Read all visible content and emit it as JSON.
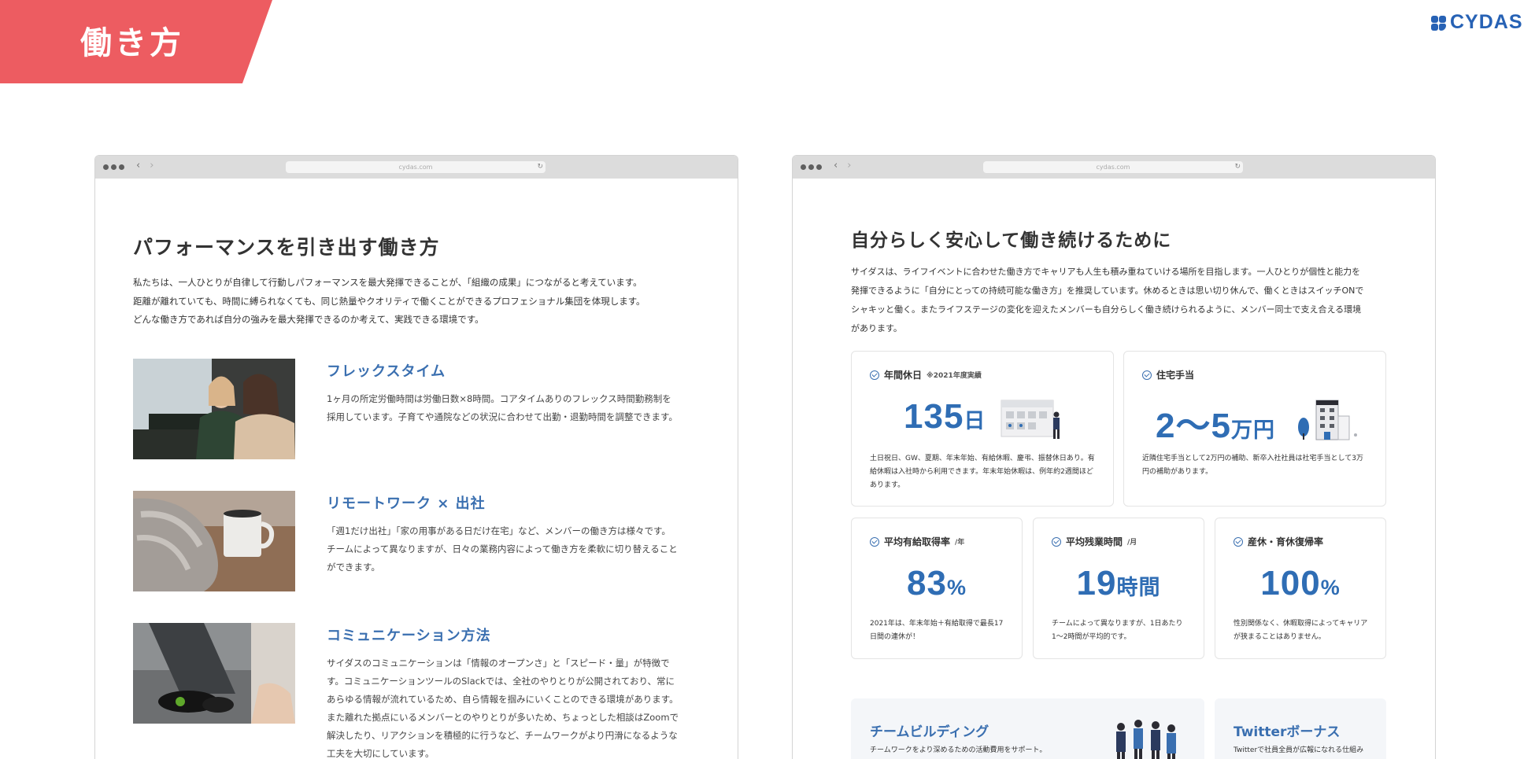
{
  "banner": {
    "title": "働き方"
  },
  "logo": {
    "text": "CYDAS"
  },
  "browser": {
    "url": "cydas.com"
  },
  "left": {
    "title": "パフォーマンスを引き出す働き方",
    "intro": [
      "私たちは、一人ひとりが自律して行動しパフォーマンスを最大発揮できることが、「組織の成果」につながると考えています。",
      "距離が離れていても、時間に縛られなくても、同じ熱量やクオリティで働くことができるプロフェショナル集団を体現します。",
      "どんな働き方であれば自分の強みを最大発揮できるのか考えて、実践できる環境です。"
    ],
    "features": [
      {
        "title": "フレックスタイム",
        "lines": [
          "1ヶ月の所定労働時間は労働日数×8時間。コアタイムありのフレックス時間勤務制を",
          "採用しています。子育てや通院などの状況に合わせて出勤・退勤時間を調整できます。"
        ]
      },
      {
        "title": "リモートワーク × 出社",
        "lines": [
          "「週1だけ出社」「家の用事がある日だけ在宅」など、メンバーの働き方は様々です。",
          "チームによって異なりますが、日々の業務内容によって働き方を柔軟に切り替えること",
          "ができます。"
        ]
      },
      {
        "title": "コミュニケーション方法",
        "lines": [
          "サイダスのコミュニケーションは「情報のオープンさ」と「スピード・量」が特徴で",
          "す。コミュニケーションツールのSlackでは、全社のやりとりが公開されており、常に",
          "あらゆる情報が流れているため、自ら情報を掴みにいくことのできる環境があります。",
          "また離れた拠点にいるメンバーとのやりとりが多いため、ちょっとした相談はZoomで",
          "解決したり、リアクションを積極的に行うなど、チームワークがより円滑になるような",
          "工夫を大切にしています。"
        ]
      }
    ]
  },
  "right": {
    "title": "自分らしく安心して働き続けるために",
    "intro": [
      "サイダスは、ライフイベントに合わせた働き方でキャリアも人生も積み重ねていける場所を目指します。一人ひとりが個性と能力を",
      "発揮できるように「自分にとっての持続可能な働き方」を推奨しています。休めるときは思い切り休んで、働くときはスイッチONで",
      "シャキッと働く。またライフステージの変化を迎えたメンバーも自分らしく働き続けられるように、メンバー同士で支え合える環境",
      "があります。"
    ],
    "cards": {
      "holidays": {
        "label": "年間休日",
        "note": "※2021年度実績",
        "value": "135",
        "unit": "日",
        "lines": [
          "土日祝日、GW、夏期、年末年始、有給休暇、慶弔、振替休日あり。有",
          "給休暇は入社時から利用できます。年末年始休暇は、例年約2週間ほど",
          "あります。"
        ]
      },
      "housing": {
        "label": "住宅手当",
        "value": "2〜5",
        "unit": "万円",
        "lines": [
          "近隣住宅手当として2万円の補助、新卒入社社員は社宅手当として3万",
          "円の補助があります。"
        ]
      },
      "paid_leave": {
        "label": "平均有給取得率",
        "suffix": "/年",
        "value": "83",
        "unit": "%",
        "lines": [
          "2021年は、年末年始＋有給取得で最長17",
          "日間の連休が！"
        ]
      },
      "overtime": {
        "label": "平均残業時間",
        "suffix": "/月",
        "value": "19",
        "unit": "時間",
        "lines": [
          "チームによって異なりますが、1日あたり",
          "1〜2時間が平均的です。"
        ]
      },
      "return_rate": {
        "label": "産休・育休復帰率",
        "value": "100",
        "unit": "%",
        "lines": [
          "性別関係なく、休暇取得によってキャリア",
          "が狭まることはありません。"
        ]
      }
    },
    "bottom": [
      {
        "title": "チームビルディング",
        "text": "チームワークをより深めるための活動費用をサポート。"
      },
      {
        "title": "Twitterボーナス",
        "text": "Twitterで社員全員が広報になれる仕組み"
      }
    ]
  }
}
